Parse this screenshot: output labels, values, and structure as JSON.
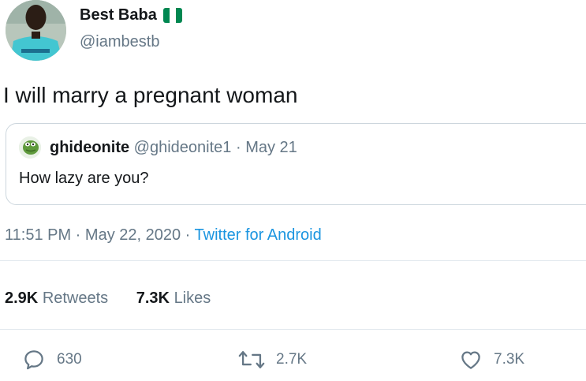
{
  "author": {
    "name": "Best Baba",
    "handle": "@iambestb",
    "flag_colors": [
      "#008751",
      "#ffffff",
      "#008751"
    ]
  },
  "tweet": {
    "text": "I will marry a pregnant woman"
  },
  "quoted": {
    "name": "ghideonite",
    "handle": "@ghideonite1",
    "separator": " · ",
    "date": "May 21",
    "text": "How lazy are you?"
  },
  "meta": {
    "time": "11:51 PM",
    "separator": " · ",
    "date": "May 22, 2020",
    "source": "Twitter for Android"
  },
  "stats": {
    "retweets_count": "2.9K",
    "retweets_label": "Retweets",
    "likes_count": "7.3K",
    "likes_label": "Likes"
  },
  "actions": {
    "reply_count": "630",
    "retweet_count": "2.7K",
    "like_count": "7.3K"
  },
  "colors": {
    "text": "#14171a",
    "secondary": "#657786",
    "link": "#1b95e0",
    "border": "#ccd6dd"
  }
}
